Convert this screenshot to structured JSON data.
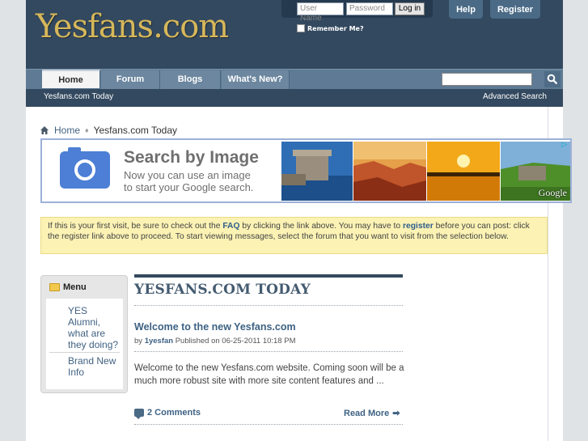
{
  "header": {
    "logo_text": "Yesfans.com",
    "login": {
      "username_placeholder": "User Name",
      "password_placeholder": "Password",
      "login_button": "Log in",
      "remember_label": "Remember Me?"
    },
    "help_button": "Help",
    "register_button": "Register"
  },
  "nav": {
    "tabs": [
      {
        "label": "Home",
        "active": true
      },
      {
        "label": "Forum",
        "active": false
      },
      {
        "label": "Blogs",
        "active": false
      },
      {
        "label": "What's New?",
        "active": false
      }
    ],
    "search_button_icon": "search-icon"
  },
  "subnav": {
    "left": "Yesfans.com Today",
    "right": "Advanced Search"
  },
  "breadcrumb": {
    "home": "Home",
    "current": "Yesfans.com Today"
  },
  "ad": {
    "title": "Search by Image",
    "line1": "Now you can use an image",
    "line2": "to start your Google search.",
    "brand": "Google"
  },
  "notice": {
    "part1": "If this is your first visit, be sure to check out the ",
    "faq": "FAQ",
    "part2": " by clicking the link above. You may have to ",
    "register": "register",
    "part3": " before you can post: click the register link above to proceed. To start viewing messages, select the forum that you want to visit from the selection below."
  },
  "menu": {
    "title": "Menu",
    "items": [
      {
        "label": "YES Alumni, what are they doing?"
      },
      {
        "label": "Brand New Info"
      }
    ]
  },
  "main": {
    "title": "YESFANS.COM TODAY",
    "post": {
      "title": "Welcome to the new Yesfans.com",
      "by": "by",
      "author": "1yesfan",
      "published": "Published on 06-25-2011 10:18 PM",
      "body": "Welcome to the new Yesfans.com website. Coming soon will be a much more robust site with more site content features and ...",
      "comments": "2 Comments",
      "read_more": "Read More"
    }
  },
  "colors": {
    "header_bg": "#33495f",
    "nav_bg": "#5e7a94",
    "link": "#3e6284",
    "logo_gold": "#d6b75a",
    "notice_bg": "#fbf2b4"
  }
}
